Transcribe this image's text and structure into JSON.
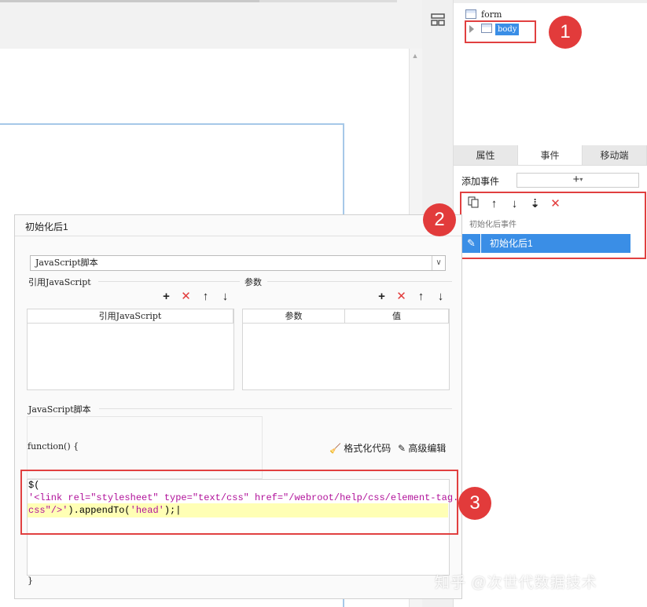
{
  "tree": {
    "form_label": "form",
    "body_label": "body"
  },
  "panel_tabs": [
    "属性",
    "事件",
    "移动端"
  ],
  "events": {
    "add_label": "添加事件",
    "add_button": "+",
    "group_label": "初始化后事件",
    "selected_item": "初始化后1"
  },
  "dialog": {
    "title": "初始化后1",
    "script_type": "JavaScript脚本",
    "ref_js_section": "引用JavaScript",
    "params_section": "参数",
    "ref_js_column": "引用JavaScript",
    "param_columns": [
      "参数",
      "值"
    ],
    "js_script_section": "JavaScript脚本",
    "function_open": "function() {",
    "format_code": "格式化代码",
    "advanced_edit": "高级编辑",
    "code": {
      "line1": "$(",
      "line2": "'<link rel=\"stylesheet\" type=\"text/css\" href=\"/webroot/help/css/element-tag.",
      "line3_string": "css\"/>'",
      "line3_rest": ").appendTo(",
      "line3_arg": "'head'",
      "line3_end": ");"
    },
    "function_close": "}"
  },
  "callouts": [
    "1",
    "2",
    "3"
  ],
  "watermark": "知乎 @次世代数据技术",
  "colors": {
    "accent_blue": "#3a8ee6",
    "callout_red": "#e23b3b",
    "code_string": "#b1129a",
    "code_highlight": "#ffffb5"
  }
}
